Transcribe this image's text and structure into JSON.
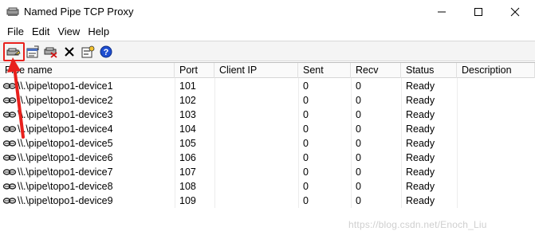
{
  "window": {
    "title": "Named Pipe TCP Proxy"
  },
  "menu": [
    "File",
    "Edit",
    "View",
    "Help"
  ],
  "toolbar_icons": [
    "new-proxy-icon",
    "properties-icon",
    "remove-proxy-icon",
    "delete-icon",
    "settings-icon",
    "help-icon"
  ],
  "columns": [
    "Pipe name",
    "Port",
    "Client IP",
    "Sent",
    "Recv",
    "Status",
    "Description"
  ],
  "rows": [
    {
      "pipe": "\\\\.\\pipe\\topo1-device1",
      "port": "101",
      "client_ip": "",
      "sent": "0",
      "recv": "0",
      "status": "Ready",
      "description": ""
    },
    {
      "pipe": "\\\\.\\pipe\\topo1-device2",
      "port": "102",
      "client_ip": "",
      "sent": "0",
      "recv": "0",
      "status": "Ready",
      "description": ""
    },
    {
      "pipe": "\\\\.\\pipe\\topo1-device3",
      "port": "103",
      "client_ip": "",
      "sent": "0",
      "recv": "0",
      "status": "Ready",
      "description": ""
    },
    {
      "pipe": "\\\\.\\pipe\\topo1-device4",
      "port": "104",
      "client_ip": "",
      "sent": "0",
      "recv": "0",
      "status": "Ready",
      "description": ""
    },
    {
      "pipe": "\\\\.\\pipe\\topo1-device5",
      "port": "105",
      "client_ip": "",
      "sent": "0",
      "recv": "0",
      "status": "Ready",
      "description": ""
    },
    {
      "pipe": "\\\\.\\pipe\\topo1-device6",
      "port": "106",
      "client_ip": "",
      "sent": "0",
      "recv": "0",
      "status": "Ready",
      "description": ""
    },
    {
      "pipe": "\\\\.\\pipe\\topo1-device7",
      "port": "107",
      "client_ip": "",
      "sent": "0",
      "recv": "0",
      "status": "Ready",
      "description": ""
    },
    {
      "pipe": "\\\\.\\pipe\\topo1-device8",
      "port": "108",
      "client_ip": "",
      "sent": "0",
      "recv": "0",
      "status": "Ready",
      "description": ""
    },
    {
      "pipe": "\\\\.\\pipe\\topo1-device9",
      "port": "109",
      "client_ip": "",
      "sent": "0",
      "recv": "0",
      "status": "Ready",
      "description": ""
    }
  ],
  "watermark": "https://blog.csdn.net/Enoch_Liu",
  "colors": {
    "highlight": "#e8201c",
    "help_blue": "#1f4fd1"
  }
}
